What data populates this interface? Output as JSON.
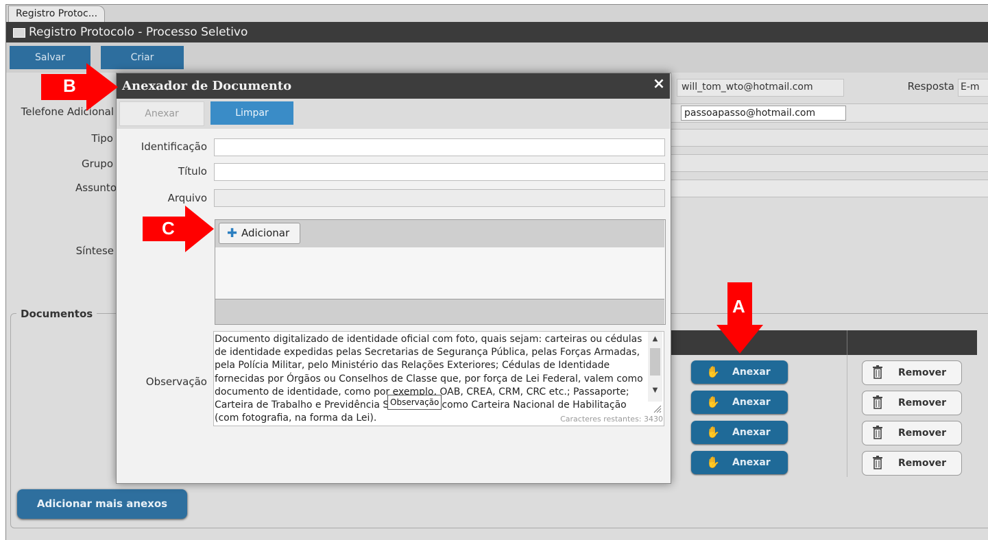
{
  "window": {
    "tab_label": "Registro Protoc...",
    "title": "Registro Protocolo - Processo Seletivo"
  },
  "toolbar": {
    "save_label": "Salvar",
    "create_label": "Criar"
  },
  "form_bg": {
    "telefone_label": "Telefone Adicional",
    "tipo_label": "Tipo",
    "grupo_label": "Grupo",
    "assunto_label": "Assunto",
    "sintese_label": "Síntese",
    "email_value": "will_tom_wto@hotmail.com",
    "email_adicional_value": "passoapasso@hotmail.com",
    "resposta_label": "Resposta",
    "resposta_value": "E-m"
  },
  "documents": {
    "legend": "Documentos",
    "anexar_label": "Anexar",
    "remover_label": "Remover",
    "add_more_label": "Adicionar mais anexos"
  },
  "modal": {
    "title": "Anexador de Documento",
    "close": "×",
    "anexar_label": "Anexar",
    "limpar_label": "Limpar",
    "identificacao_label": "Identificação",
    "titulo_label": "Título",
    "arquivo_label": "Arquivo",
    "adicionar_label": "Adicionar",
    "observacao_label": "Observação",
    "observacao_text": "Documento digitalizado de identidade oficial com foto, quais sejam: carteiras ou cédulas de identidade expedidas pelas Secretarias de Segurança Pública, pelas Forças Armadas, pela Polícia Militar, pelo Ministério das Relações Exteriores; Cédulas de Identidade fornecidas por Órgãos ou Conselhos de Classe que, por força de Lei Federal, valem como documento de identidade, como por exemplo, OAB, CREA, CRM, CRC etc.; Passaporte; Carteira de Trabalho e Previdência Social, bem como Carteira Nacional de Habilitação (com fotografia, na forma da Lei).",
    "counter": "Caracteres restantes: 3430",
    "tooltip": "Observação"
  },
  "annotations": {
    "a": "A",
    "b": "B",
    "c": "C"
  },
  "colors": {
    "arrow": "#ff0000",
    "primary_button": "#1f6a98",
    "title_bar": "#3b3b3b"
  }
}
